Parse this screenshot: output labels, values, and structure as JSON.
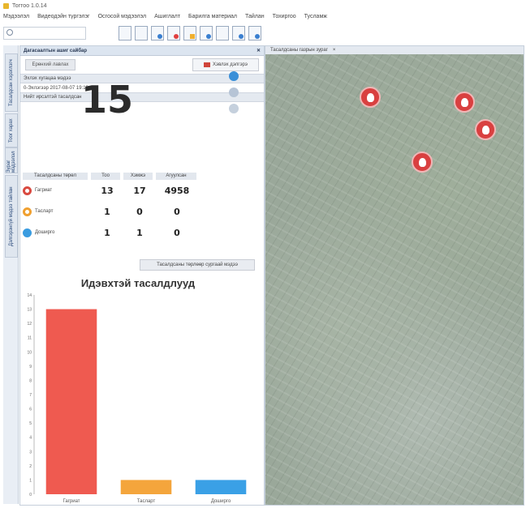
{
  "window": {
    "title": "Тогтоо 1.0.14"
  },
  "menu": [
    "Мэдээлэл",
    "Видеодэйн түргэлэг",
    "Осгосой мэдээлэл",
    "Ашиглалт",
    "Барилга материал",
    "Тайлан",
    "Тохиргоо",
    "Тусламж"
  ],
  "panel": {
    "header": "Дагасаалтын ашиг сайбар",
    "button_left": "Ерөнхий лавлах",
    "button_print": "Хэвлэх дэлгэрэ",
    "date_section": "Эхлэх хугацаа мэдээ",
    "date_value": "0-Эхлэгээр 2017-08-07 19:13:23",
    "count_section": "Нийт ирсэлтэй тасалдсан",
    "big_count": "15",
    "table_headers": [
      "Тасалдсаны төрөл",
      "Тоо",
      "Хэмжэ",
      "Агуулсан"
    ],
    "rows": [
      {
        "name": "Гагриат",
        "v1": "13",
        "v2": "17",
        "v3": "4958"
      },
      {
        "name": "Тасларт",
        "v1": "1",
        "v2": "0",
        "v3": "0"
      },
      {
        "name": "Доширго",
        "v1": "1",
        "v2": "1",
        "v3": "0"
      }
    ],
    "detail_button": "Тасалдсаны төрлөөр сургаай мэдээ"
  },
  "side_tabs": [
    "Дэлгэрэнгүй мэдээ тайлан",
    "Тасалдсан хэрэглэгч",
    "Тоог харах",
    "Зураг мэдээлэл"
  ],
  "map": {
    "tab": "Тасалдсаны газрын зураг",
    "close": "×"
  },
  "colors": {
    "red": "#ef5a50",
    "orange": "#f4a53c",
    "blue": "#3aa0e6"
  },
  "chart_data": {
    "type": "bar",
    "title": "Идэвхтэй тасалдлууд",
    "categories": [
      "Гагриат",
      "Тасларт",
      "Доширго"
    ],
    "values": [
      13,
      1,
      1
    ],
    "ylim": [
      0,
      14
    ],
    "yticks": [
      "0",
      "1",
      "2",
      "3",
      "4",
      "5",
      "6",
      "7",
      "8",
      "9",
      "10",
      "11",
      "12",
      "13",
      "14"
    ],
    "colors": [
      "#ef5a50",
      "#f4a53c",
      "#3aa0e6"
    ],
    "grid": false
  }
}
